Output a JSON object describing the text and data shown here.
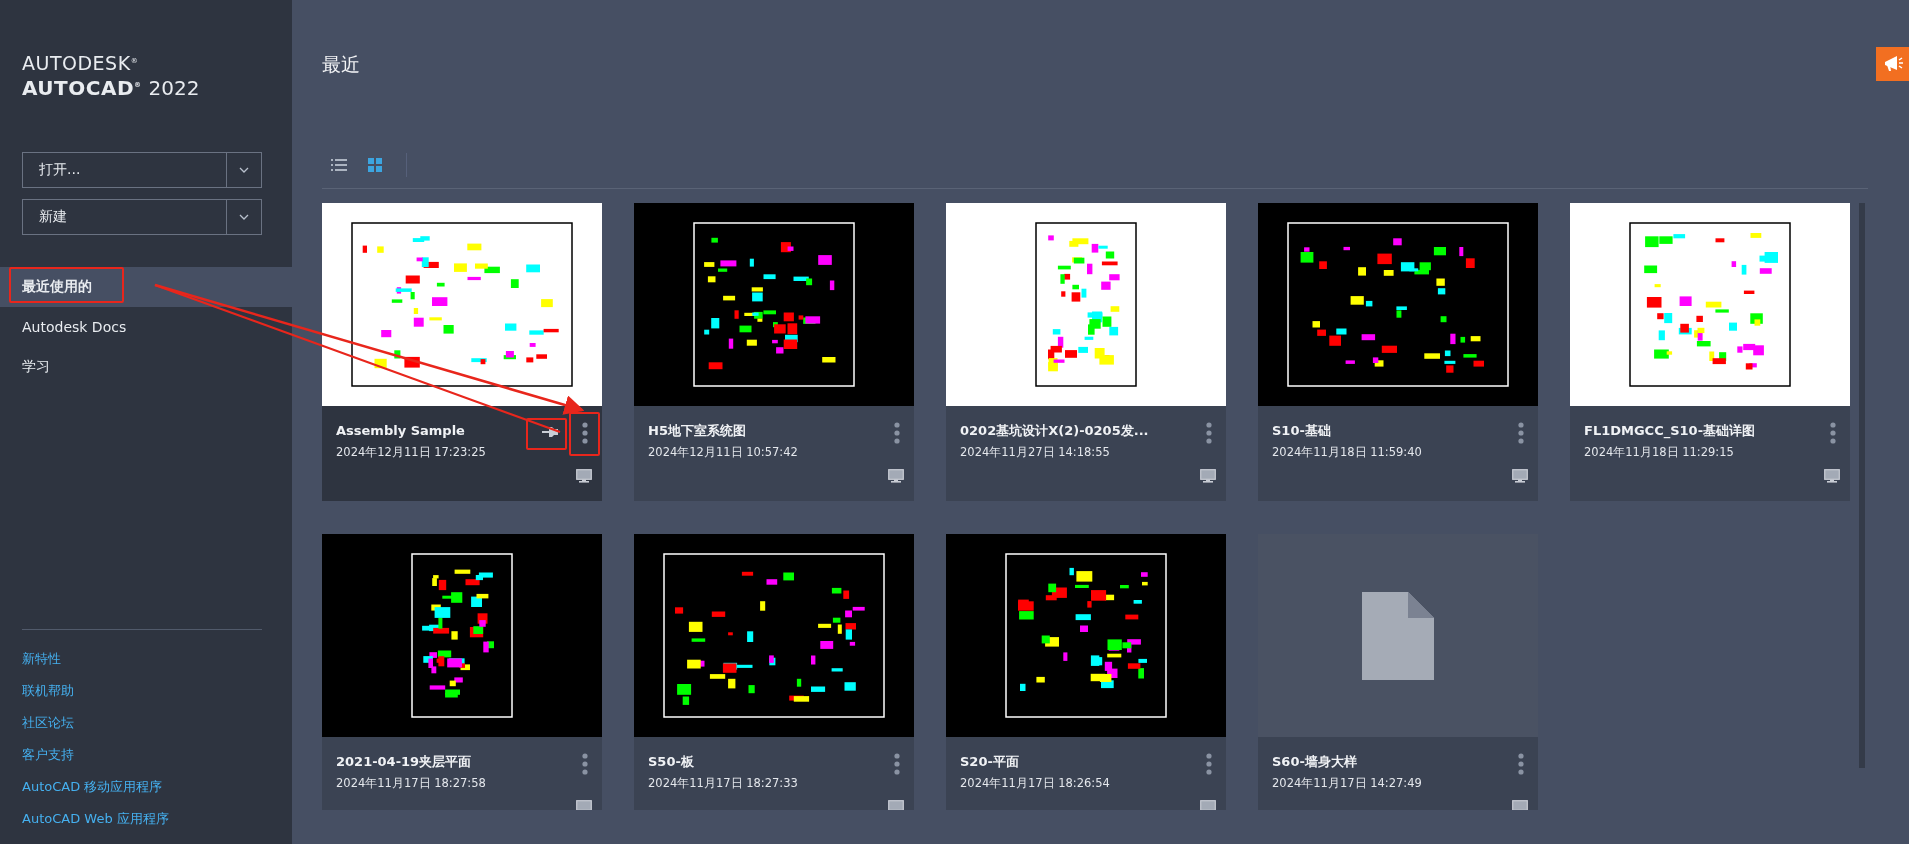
{
  "app": {
    "brand": "AUTODESK$^{®}$",
    "product": "AUTOCAD$^{®}$",
    "version": "2022"
  },
  "sidebar": {
    "actions": [
      {
        "label": "打开..."
      },
      {
        "label": "新建"
      }
    ],
    "nav": [
      {
        "label": "最近使用的",
        "selected": true
      },
      {
        "label": "Autodesk Docs",
        "selected": false
      },
      {
        "label": "学习",
        "selected": false
      }
    ],
    "links": [
      "新特性",
      "联机帮助",
      "社区论坛",
      "客户支持",
      "AutoCAD 移动应用程序",
      "AutoCAD Web 应用程序"
    ]
  },
  "main": {
    "title": "最近",
    "view_modes": [
      {
        "kind": "list",
        "selected": false
      },
      {
        "kind": "grid",
        "selected": true
      }
    ],
    "files": [
      {
        "name": "Assembly Sample",
        "date": "2024年12月11日 17:23:25",
        "kind": "light",
        "pinned": true,
        "selected": true
      },
      {
        "name": "H5地下室系统图",
        "date": "2024年12月11日 10:57:42",
        "kind": "dark",
        "pinned": false,
        "selected": false
      },
      {
        "name": "0202基坑设计X(2)-0205发...",
        "date": "2024年11月27日 14:18:55",
        "kind": "light",
        "pinned": false,
        "selected": false
      },
      {
        "name": "S10-基础",
        "date": "2024年11月18日 11:59:40",
        "kind": "dark",
        "pinned": false,
        "selected": false
      },
      {
        "name": "FL1DMGCC_S10-基础详图",
        "date": "2024年11月18日 11:29:15",
        "kind": "light",
        "pinned": false,
        "selected": false
      },
      {
        "name": "2021-04-19夹层平面",
        "date": "2024年11月17日 18:27:58",
        "kind": "dark",
        "pinned": false,
        "selected": false
      },
      {
        "name": "S50-板",
        "date": "2024年11月17日 18:27:33",
        "kind": "dark",
        "pinned": false,
        "selected": false
      },
      {
        "name": "S20-平面",
        "date": "2024年11月17日 18:26:54",
        "kind": "dark",
        "pinned": false,
        "selected": false
      },
      {
        "name": "S60-墙身大样",
        "date": "2024年11月17日 14:27:49",
        "kind": "none",
        "pinned": false,
        "selected": false
      }
    ]
  }
}
